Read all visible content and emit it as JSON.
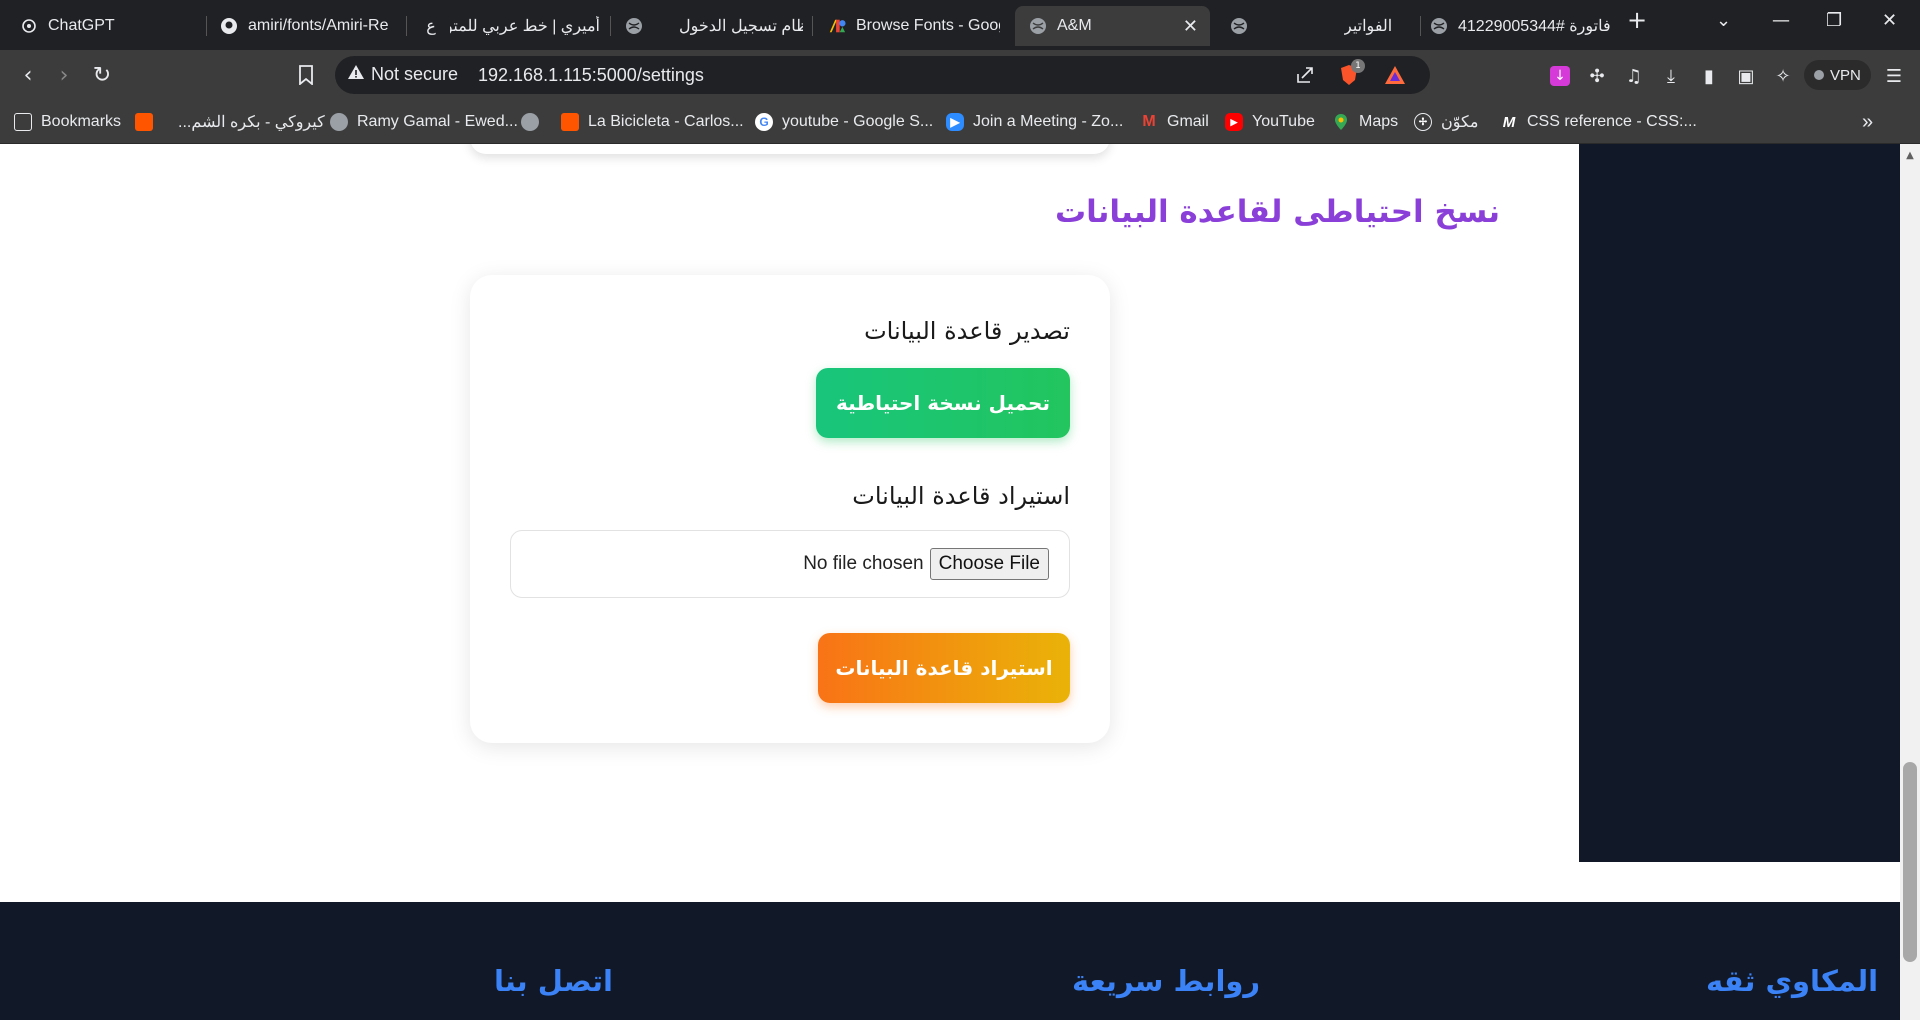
{
  "browser": {
    "tabs": [
      {
        "label": "ChatGPT",
        "icon": "openai-icon"
      },
      {
        "label": "amiri/fonts/Amiri-Re",
        "icon": "github-icon"
      },
      {
        "label": "أميري | خط عربي للمتو",
        "icon": "calligraphy-icon"
      },
      {
        "label": "نظام تسجيل الدخول",
        "icon": "globe-icon"
      },
      {
        "label": "Browse Fonts - Goog",
        "icon": "google-fonts-icon"
      },
      {
        "label": "A&M",
        "icon": "globe-icon",
        "active": true
      },
      {
        "label": "الفواتير",
        "icon": "globe-icon"
      },
      {
        "label": "فاتورة #41229005344",
        "icon": "globe-icon"
      }
    ],
    "not_secure_label": "Not secure",
    "url": "192.168.1.115:5000/settings",
    "vpn_label": "VPN",
    "brave_badge": "1",
    "bookmarks": [
      {
        "label": "Bookmarks",
        "icon": "bookmarks-icon"
      },
      {
        "label": "",
        "icon": "soundcloud-icon"
      },
      {
        "label": "كيروكي - بكره الشم...",
        "icon": "none"
      },
      {
        "label": "Ramy Gamal - Ewed...",
        "icon": "globe-icon"
      },
      {
        "label": "",
        "icon": "globe-icon"
      },
      {
        "label": "La Bicicleta - Carlos...",
        "icon": "soundcloud-icon"
      },
      {
        "label": "youtube - Google S...",
        "icon": "google-icon"
      },
      {
        "label": "Join a Meeting - Zo...",
        "icon": "zoom-icon"
      },
      {
        "label": "Gmail",
        "icon": "gmail-icon"
      },
      {
        "label": "YouTube",
        "icon": "youtube-icon"
      },
      {
        "label": "Maps",
        "icon": "maps-icon"
      },
      {
        "label": "مكوّن",
        "icon": "mercedes-icon"
      },
      {
        "label": "CSS reference - CSS:...",
        "icon": "mdn-icon"
      }
    ]
  },
  "page": {
    "section_title": "نسخ احتياطى لقاعدة البيانات",
    "export_label": "تصدير قاعدة البيانات",
    "download_button": "تحميل نسخة احتياطية",
    "import_label": "استيراد قاعدة البيانات",
    "file_input": {
      "no_file": "No file chosen",
      "choose": "Choose File"
    },
    "import_button": "استيراد قاعدة البيانات"
  },
  "footer": {
    "contact": "اتصل بنا",
    "quick_links": "روابط سريعة",
    "brand": "المكاوي ثقه"
  },
  "colors": {
    "accent_purple": "#8b3fd9",
    "green": "#22c55e",
    "orange": "#f97316",
    "navy": "#111827",
    "footer_heading": "#3b82f6"
  }
}
